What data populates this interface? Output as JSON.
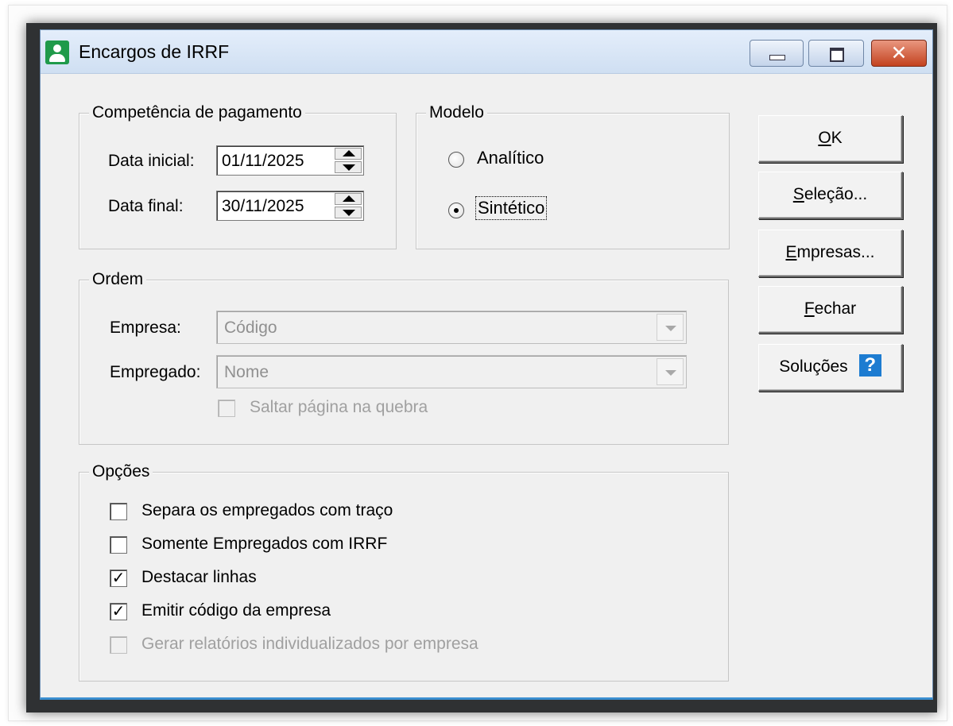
{
  "window": {
    "title": "Encargos de IRRF",
    "controls": {
      "minimize": "minimize-icon",
      "maximize": "maximize-icon",
      "close": "close-icon"
    }
  },
  "competencia": {
    "legend": "Competência de pagamento",
    "data_inicial_label": "Data inicial:",
    "data_inicial_value": "01/11/2025",
    "data_final_label": "Data final:",
    "data_final_value": "30/11/2025"
  },
  "modelo": {
    "legend": "Modelo",
    "options": [
      {
        "label": "Analítico",
        "checked": false
      },
      {
        "label": "Sintético",
        "checked": true
      }
    ]
  },
  "ordem": {
    "legend": "Ordem",
    "empresa_label": "Empresa:",
    "empresa_value": "Código",
    "empregado_label": "Empregado:",
    "empregado_value": "Nome",
    "saltar_label": "Saltar página na quebra",
    "saltar_checked": false
  },
  "opcoes": {
    "legend": "Opções",
    "items": [
      {
        "label": "Separa os empregados com traço",
        "checked": false,
        "enabled": true
      },
      {
        "label": "Somente Empregados com IRRF",
        "checked": false,
        "enabled": true
      },
      {
        "label": "Destacar linhas",
        "checked": true,
        "enabled": true
      },
      {
        "label": "Emitir código da empresa",
        "checked": true,
        "enabled": true
      },
      {
        "label": "Gerar relatórios individualizados por empresa",
        "checked": false,
        "enabled": false
      }
    ]
  },
  "buttons": {
    "ok": {
      "mnemonic": "O",
      "rest": "K"
    },
    "selecao": {
      "mnemonic": "S",
      "rest": "eleção..."
    },
    "empresas": {
      "mnemonic": "E",
      "rest": "mpresas..."
    },
    "fechar": {
      "mnemonic": "F",
      "rest": "echar"
    },
    "solucoes": {
      "label": "Soluções",
      "icon": "help-icon",
      "icon_text": "?"
    }
  },
  "colors": {
    "app_icon": "#1f9a4a",
    "help_icon": "#1d7cd1",
    "close_button": "#c3421f"
  }
}
